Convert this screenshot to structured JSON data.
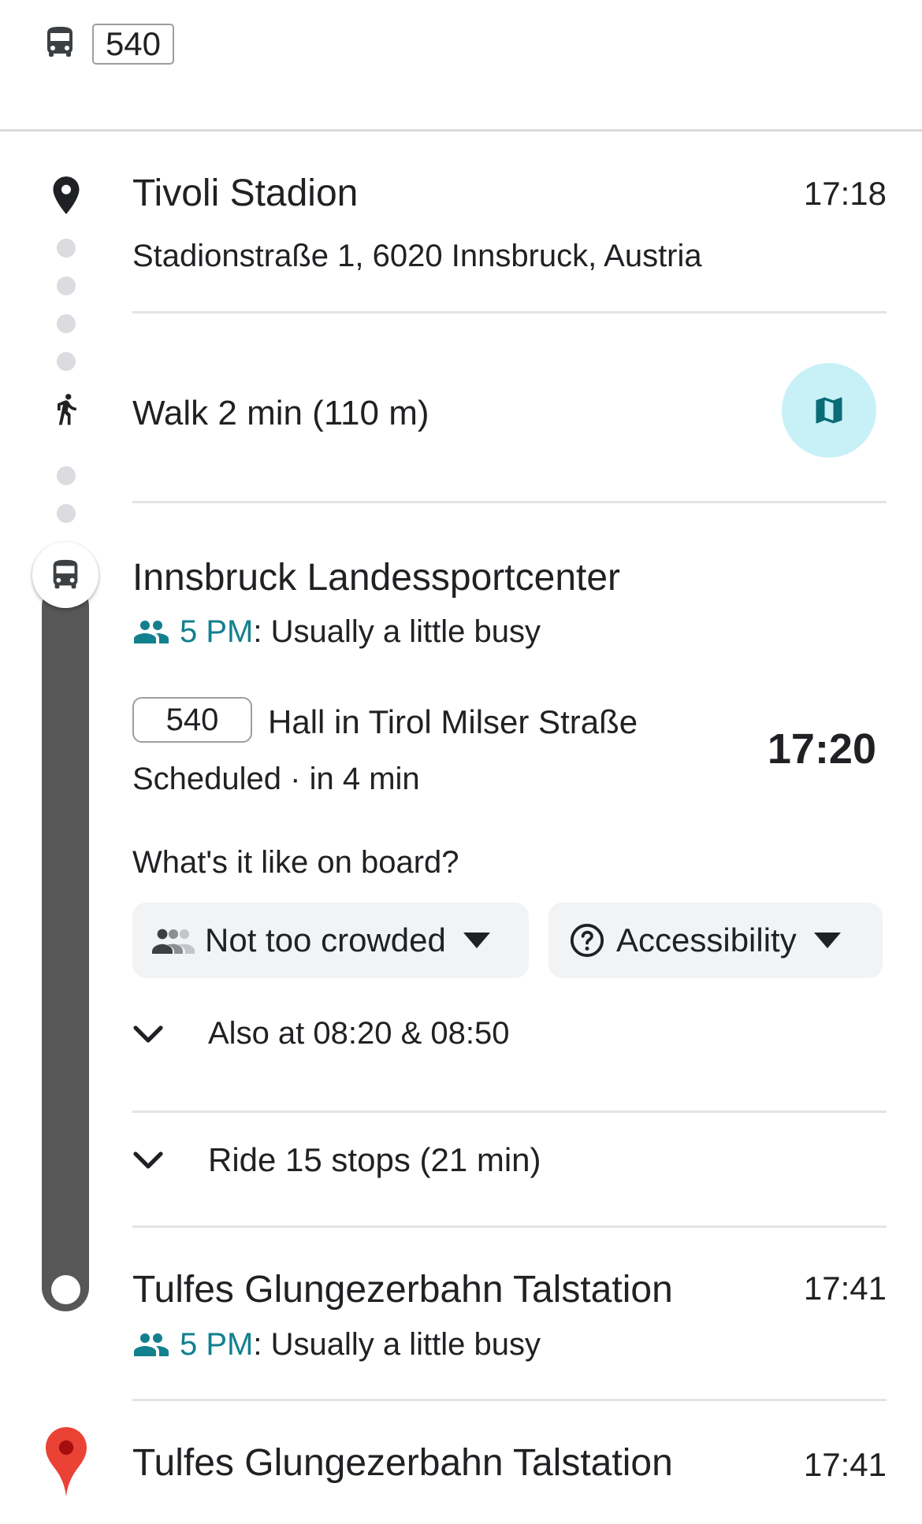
{
  "header": {
    "route": "540"
  },
  "origin": {
    "name": "Tivoli Stadion",
    "address": "Stadionstraße 1, 6020 Innsbruck, Austria",
    "time": "17:18"
  },
  "walk": {
    "label": "Walk 2 min (110 m)"
  },
  "board_stop": {
    "name": "Innsbruck Landessportcenter",
    "busy_time": "5 PM",
    "busy_text": ": Usually a little busy",
    "route": "540",
    "headsign": "Hall in Tirol Milser Straße",
    "status": "Scheduled · in 4 min",
    "departure_time": "17:20",
    "onboard_question": "What's it like on board?",
    "crowd_chip": "Not too crowded",
    "accessibility_chip": "Accessibility",
    "also_at": "Also at 08:20 & 08:50",
    "ride": "Ride 15 stops (21 min)"
  },
  "alight_stop": {
    "name": "Tulfes Glungezerbahn Talstation",
    "time": "17:41",
    "busy_time": "5 PM",
    "busy_text": ": Usually a little busy"
  },
  "destination": {
    "name": "Tulfes Glungezerbahn Talstation",
    "time": "17:41"
  },
  "colors": {
    "accent_teal": "#12808e",
    "map_button_bg": "#c8f1f7",
    "trip_line": "#575757",
    "pin_red": "#ea4335"
  },
  "icons": [
    "bus-icon",
    "location-pin-icon",
    "walk-icon",
    "map-icon",
    "people-icon",
    "dropdown-arrow-icon",
    "help-circle-icon",
    "chevron-down-icon",
    "red-pin-icon"
  ]
}
